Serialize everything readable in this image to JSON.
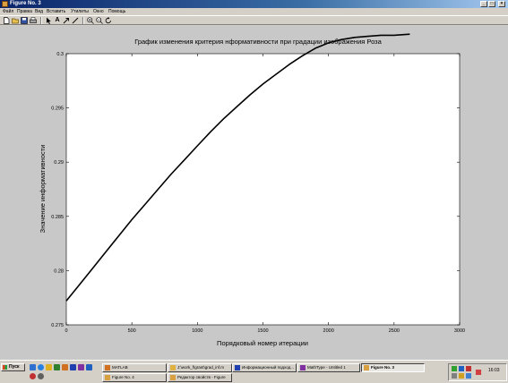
{
  "window": {
    "title": "Figure No. 3",
    "controls": [
      "_",
      "□",
      "×"
    ]
  },
  "menu": [
    "Файл",
    "Правка",
    "Вид",
    "Вставить",
    "Утилиты",
    "Окно",
    "Помощь"
  ],
  "toolbar": {
    "icons": [
      "new-file-icon",
      "open-folder-icon",
      "save-icon",
      "print-icon",
      "pointer-icon",
      "text-icon",
      "arrow-icon",
      "line-icon",
      "zoom-in-icon",
      "zoom-out-icon",
      "rotate-icon"
    ],
    "text_tool_label": "A"
  },
  "chart_data": {
    "type": "line",
    "title": "График изменения критерия нформативности  при градации изображения Роза",
    "xlabel": "Порядковый номер итерации",
    "ylabel": "Значение информативности",
    "xlim": [
      0,
      3000
    ],
    "ylim": [
      0.275,
      0.3
    ],
    "xticks": [
      "0",
      "500",
      "1000",
      "1500",
      "2000",
      "2500",
      "3000"
    ],
    "yticks": [
      "0.275",
      "0.28",
      "0.285",
      "0.29",
      "0.295",
      "0.3"
    ],
    "grid": false,
    "series": [
      {
        "color": "#000000",
        "x": [
          0,
          100,
          200,
          300,
          400,
          500,
          600,
          700,
          800,
          900,
          1000,
          1100,
          1200,
          1300,
          1400,
          1500,
          1600,
          1700,
          1800,
          1900,
          2000,
          2100,
          2200,
          2300,
          2400,
          2500,
          2620
        ],
        "y": [
          0.2772,
          0.2787,
          0.2802,
          0.2817,
          0.2832,
          0.2847,
          0.2861,
          0.2875,
          0.2889,
          0.2902,
          0.2915,
          0.2928,
          0.294,
          0.2951,
          0.2962,
          0.2972,
          0.2981,
          0.299,
          0.2998,
          0.3005,
          0.301,
          0.3013,
          0.3015,
          0.3016,
          0.3017,
          0.3017,
          0.3018
        ]
      }
    ]
  },
  "taskbar": {
    "start_label": "Пуск",
    "tasks": [
      {
        "label": "MATLAB",
        "icon": "matlab-icon",
        "active": false
      },
      {
        "label": "J:\\work_f\\grant\\grad_inf.m",
        "icon": "editor-icon",
        "active": false
      },
      {
        "label": "Информационный подход...",
        "icon": "document-icon",
        "active": false
      },
      {
        "label": "MathType - Untitled 1",
        "icon": "mathtype-icon",
        "active": false
      },
      {
        "label": "Figure No. 3",
        "icon": "figure-icon",
        "active": true
      },
      {
        "label": "Figure No. 4",
        "icon": "figure-icon",
        "active": false
      },
      {
        "label": "Редактор свойств - Figure",
        "icon": "property-editor-icon",
        "active": false
      }
    ],
    "clock": "16:03"
  }
}
